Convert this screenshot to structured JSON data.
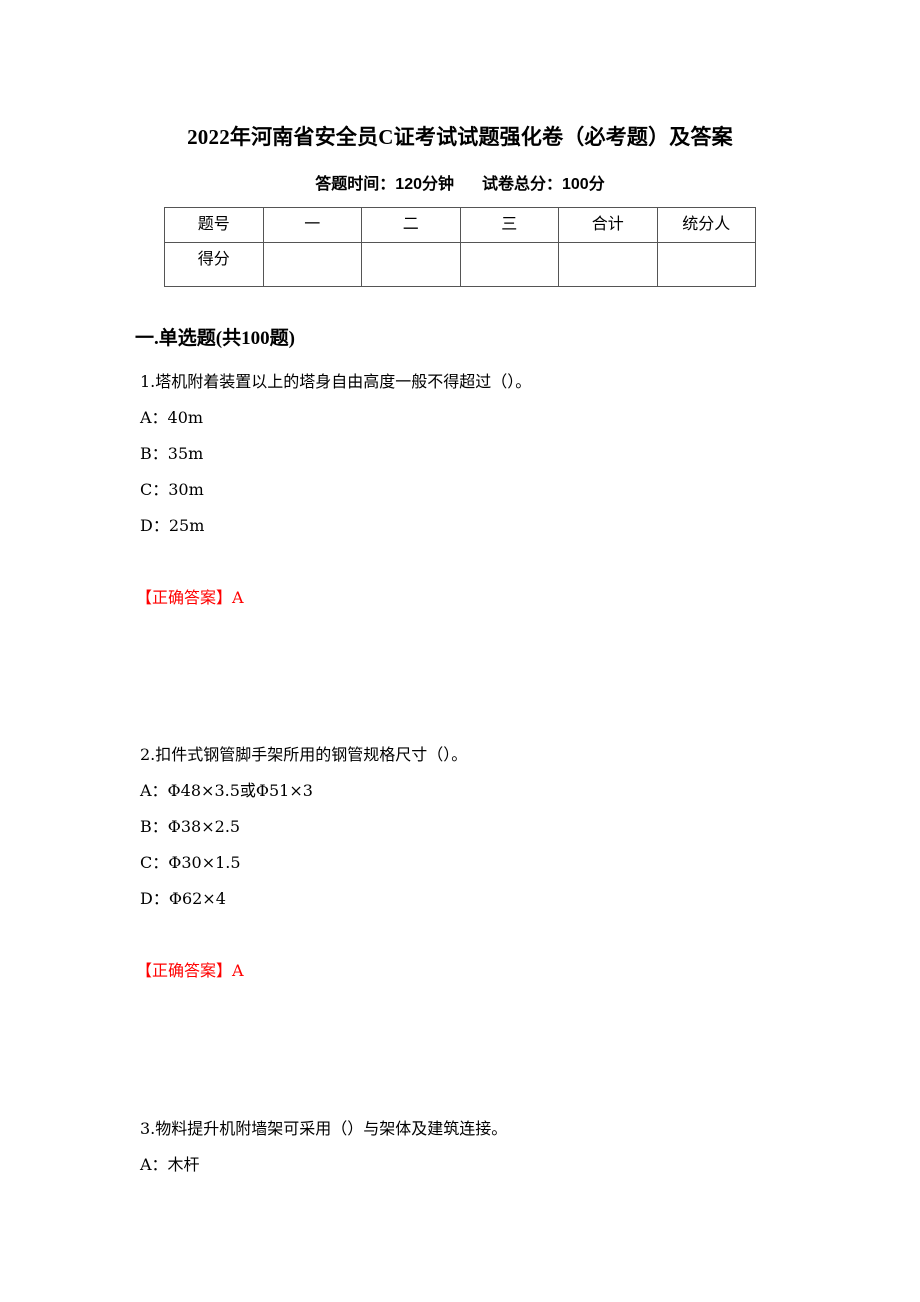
{
  "document": {
    "title": "2022年河南省安全员C证考试试题强化卷（必考题）及答案",
    "time_label": "答题时间：120分钟",
    "score_label": "试卷总分：100分"
  },
  "score_table": {
    "header": [
      "题号",
      "一",
      "二",
      "三",
      "合计",
      "统分人"
    ],
    "row": [
      "得分",
      "",
      "",
      "",
      "",
      ""
    ]
  },
  "section": {
    "heading": "一.单选题(共100题)"
  },
  "questions": [
    {
      "stem": "1.塔机附着装置以上的塔身自由高度一般不得超过（）。",
      "options": [
        "A：40m",
        "B：35m",
        "C：30m",
        "D：25m"
      ],
      "answer": "【正确答案】A"
    },
    {
      "stem": "2.扣件式钢管脚手架所用的钢管规格尺寸（）。",
      "options": [
        "A：Φ48×3.5或Φ51×3",
        "B：Φ38×2.5",
        "C：Φ30×1.5",
        "D：Φ62×4"
      ],
      "answer": "【正确答案】A"
    },
    {
      "stem": "3.物料提升机附墙架可采用（）与架体及建筑连接。",
      "options": [
        "A：木杆"
      ]
    }
  ],
  "colors": {
    "answer": "#ff0000",
    "text": "#000000"
  }
}
